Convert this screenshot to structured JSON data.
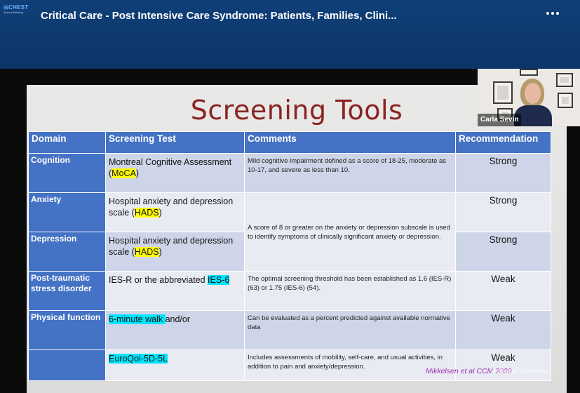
{
  "header": {
    "logo_line1_a": "⊞CHEST",
    "logo_line2": "Annual Meeting",
    "title": "Critical Care - Post Intensive Care Syndrome: Patients, Families, Clini...",
    "more_icon": "more-horizontal-icon"
  },
  "slide": {
    "title": "Screening Tools",
    "columns": [
      "Domain",
      "Screening Test",
      "Comments",
      "Recommendation"
    ],
    "rows": [
      {
        "domain": "Cognition",
        "test_pre": "Montreal Cognitive Assessment (",
        "test_hl": "MoCA",
        "test_post": ")",
        "comment": "Mild cognitive impairment defined as a score of 18-25, moderate as 10-17, and severe as less than 10.",
        "recommendation": "Strong"
      },
      {
        "domain": "Anxiety",
        "test_pre": "Hospital anxiety and depression scale (",
        "test_hl": "HADS",
        "test_post": ")",
        "comment": "A score of 8 or greater on the anxiety or depression subscale is used to identify symptoms of clinically significant anxiety or depression.",
        "recommendation": "Strong"
      },
      {
        "domain": "Depression",
        "test_pre": "Hospital anxiety and depression scale (",
        "test_hl": "HADS",
        "test_post": ")",
        "recommendation": "Strong"
      },
      {
        "domain": "Post-traumatic stress disorder",
        "test_pre": "IES-R or the abbreviated ",
        "test_hl": "IES-6",
        "test_post": "",
        "comment": "The optimal screening threshold has been established as 1.6 (IES-R) (63) or 1.75 (IES-6) (54).",
        "recommendation": "Weak"
      },
      {
        "domain": "Physical function",
        "test_pre": "",
        "test_hl": "6-minute walk ",
        "test_post": " and/or",
        "comment": "Can be evaluated as a percent predicted against available normative data",
        "recommendation": "Weak"
      },
      {
        "domain": "",
        "test_pre": "",
        "test_hl": "EuroQol-5D-5L",
        "test_post": "",
        "comment": "Includes assessments of mobility, self-care, and usual activities, in addition to pain and anxiety/depression.",
        "recommendation": "Weak"
      }
    ],
    "citation": "Mikkelsen et al CCM 2020",
    "watermark": "Activate Windows"
  },
  "speaker": {
    "name": "Carla Sevin"
  },
  "colors": {
    "header_bg": "#0f3f78",
    "table_header": "#4472c4",
    "title_red": "#8b2424",
    "highlight_yellow": "#ffff00",
    "highlight_cyan": "#00e5ff",
    "citation_purple": "#9b2fae"
  }
}
